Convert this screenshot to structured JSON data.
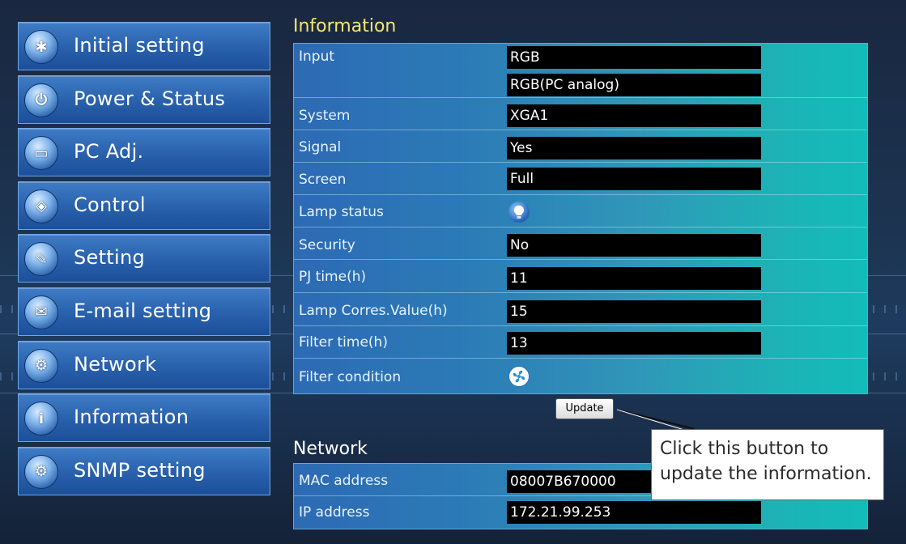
{
  "sidebar": {
    "items": [
      {
        "label": "Initial setting",
        "icon": "gear-sun-icon",
        "glyph": "✱"
      },
      {
        "label": "Power & Status",
        "icon": "power-icon",
        "glyph": "⏻"
      },
      {
        "label": "PC Adj.",
        "icon": "monitor-icon",
        "glyph": "▭"
      },
      {
        "label": "Control",
        "icon": "control-icon",
        "glyph": "◈"
      },
      {
        "label": "Setting",
        "icon": "wrench-icon",
        "glyph": "✎"
      },
      {
        "label": "E-mail setting",
        "icon": "envelope-icon",
        "glyph": "✉"
      },
      {
        "label": "Network",
        "icon": "network-icon",
        "glyph": "⚙"
      },
      {
        "label": "Information",
        "icon": "info-icon",
        "glyph": "i"
      },
      {
        "label": "SNMP setting",
        "icon": "snmp-icon",
        "glyph": "⚙"
      }
    ]
  },
  "information": {
    "title": "Information",
    "rows": {
      "input": {
        "label": "Input",
        "value1": "RGB",
        "value2": "RGB(PC analog)"
      },
      "system": {
        "label": "System",
        "value": "XGA1"
      },
      "signal": {
        "label": "Signal",
        "value": "Yes"
      },
      "screen": {
        "label": "Screen",
        "value": "Full"
      },
      "lamp_status": {
        "label": "Lamp status",
        "icon": "lamp-bulb-icon"
      },
      "security": {
        "label": "Security",
        "value": "No"
      },
      "pj_time": {
        "label": "PJ time(h)",
        "value": "11"
      },
      "lamp_corres": {
        "label": "Lamp Corres.Value(h)",
        "value": "15"
      },
      "filter_time": {
        "label": "Filter time(h)",
        "value": "13"
      },
      "filter_condition": {
        "label": "Filter condition",
        "icon": "filter-fan-icon"
      }
    },
    "update_label": "Update"
  },
  "network": {
    "title": "Network",
    "rows": {
      "mac": {
        "label": "MAC address",
        "value": "08007B670000"
      },
      "ip": {
        "label": "IP address",
        "value": "172.21.99.253"
      }
    }
  },
  "callout": {
    "line1": "Click this button to",
    "line2": "update the information."
  },
  "colors": {
    "info_title": "#f5e676",
    "nav_blue": "#2a62ae",
    "panel_teal": "#12bcb9"
  }
}
